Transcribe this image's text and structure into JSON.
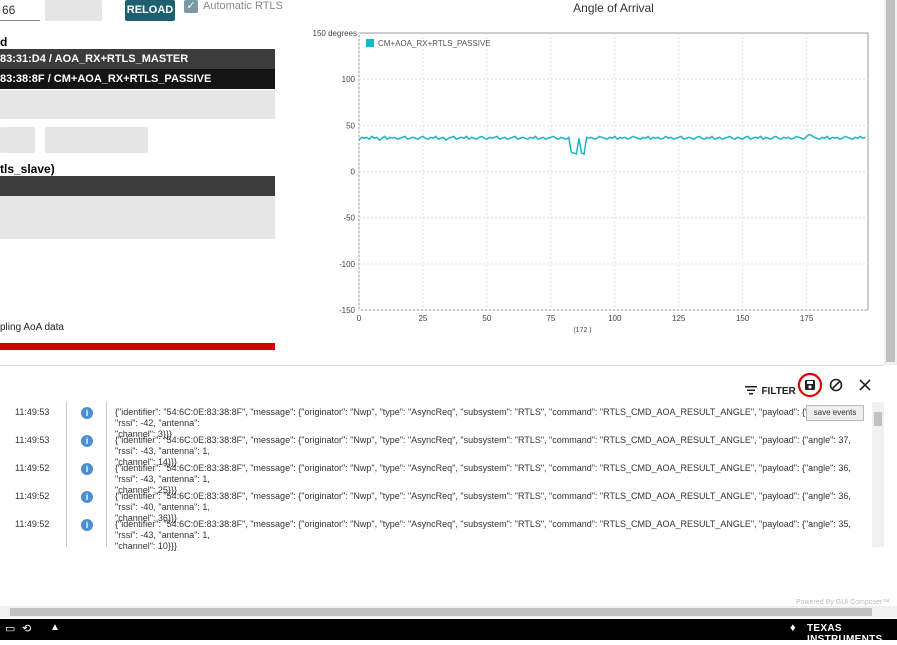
{
  "toolbar": {
    "port_value": "66",
    "reload_label": "RELOAD",
    "auto_rtls_label": "Automatic RTLS",
    "auto_rtls_checked": "✓"
  },
  "devices": {
    "title_fragment": "d",
    "items": [
      {
        "label": "83:31:D4 / AOA_RX+RTLS_MASTER"
      },
      {
        "label": "83:38:8F / CM+AOA_RX+RTLS_PASSIVE"
      }
    ]
  },
  "slave": {
    "title": "tls_slave)"
  },
  "status_text": "pling AoA data",
  "chart_data": {
    "type": "line",
    "title": "Angle of Arrival",
    "ylabel_top": "150 degrees",
    "xlabel": "(172 )",
    "xlim": [
      0,
      199
    ],
    "ylim": [
      -150,
      150
    ],
    "x_ticks": [
      0,
      25,
      50,
      75,
      100,
      125,
      150,
      175
    ],
    "y_ticks": [
      -150,
      -100,
      -50,
      0,
      50,
      100
    ],
    "grid": true,
    "legend_position": "top-left",
    "series": [
      {
        "name": "CM+AOA_RX+RTLS_PASSIVE",
        "color": "#17b6c4",
        "values": [
          34,
          37,
          36,
          37,
          35,
          38,
          36,
          37,
          34,
          36,
          38,
          35,
          37,
          36,
          37,
          35,
          36,
          37,
          38,
          35,
          36,
          37,
          36,
          35,
          37,
          38,
          36,
          35,
          37,
          36,
          38,
          35,
          36,
          37,
          34,
          36,
          37,
          38,
          35,
          36,
          37,
          36,
          38,
          35,
          37,
          36,
          35,
          37,
          38,
          36,
          35,
          37,
          36,
          37,
          38,
          35,
          36,
          37,
          35,
          36,
          37,
          38,
          35,
          36,
          37,
          36,
          35,
          37,
          36,
          38,
          35,
          36,
          37,
          35,
          36,
          37,
          38,
          36,
          35,
          37,
          36,
          35,
          37,
          21,
          20,
          19,
          36,
          20,
          19,
          37,
          36,
          37,
          35,
          36,
          38,
          37,
          36,
          35,
          37,
          36,
          38,
          35,
          37,
          36,
          37,
          35,
          36,
          38,
          37,
          36,
          35,
          37,
          36,
          38,
          35,
          37,
          36,
          37,
          35,
          36,
          38,
          36,
          37,
          35,
          36,
          37,
          38,
          35,
          36,
          37,
          36,
          35,
          37,
          38,
          36,
          35,
          37,
          36,
          38,
          35,
          36,
          37,
          35,
          36,
          37,
          38,
          36,
          35,
          37,
          36,
          35,
          37,
          38,
          35,
          36,
          37,
          36,
          38,
          35,
          37,
          36,
          35,
          37,
          38,
          36,
          35,
          37,
          36,
          37,
          35,
          36,
          38,
          37,
          36,
          35,
          38,
          40,
          39,
          37,
          36,
          35,
          37,
          36,
          38,
          35,
          37,
          36,
          37,
          35,
          36,
          38,
          37,
          36,
          35,
          37,
          36,
          38,
          36,
          37
        ]
      }
    ]
  },
  "log": {
    "filter_label": "FILTER",
    "tooltip": "save events",
    "rows": [
      {
        "time": "11:49:53",
        "msg": "{\"identifier\": \"54:6C:0E:83:38:8F\", \"message\": {\"originator\": \"Nwp\", \"type\": \"AsyncReq\", \"subsystem\": \"RTLS\", \"command\": \"RTLS_CMD_AOA_RESULT_ANGLE\", \"payload\": {\"angle\": 37, \"rssi\": -42, \"antenna\":\n\"channel\": 3}}}"
      },
      {
        "time": "11:49:53",
        "msg": "{\"identifier\": \"54:6C:0E:83:38:8F\", \"message\": {\"originator\": \"Nwp\", \"type\": \"AsyncReq\", \"subsystem\": \"RTLS\", \"command\": \"RTLS_CMD_AOA_RESULT_ANGLE\", \"payload\": {\"angle\": 37, \"rssi\": -43, \"antenna\": 1,\n\"channel\": 14}}}"
      },
      {
        "time": "11:49:52",
        "msg": "{\"identifier\": \"54:6C:0E:83:38:8F\", \"message\": {\"originator\": \"Nwp\", \"type\": \"AsyncReq\", \"subsystem\": \"RTLS\", \"command\": \"RTLS_CMD_AOA_RESULT_ANGLE\", \"payload\": {\"angle\": 36, \"rssi\": -43, \"antenna\": 1,\n\"channel\": 25}}}"
      },
      {
        "time": "11:49:52",
        "msg": "{\"identifier\": \"54:6C:0E:83:38:8F\", \"message\": {\"originator\": \"Nwp\", \"type\": \"AsyncReq\", \"subsystem\": \"RTLS\", \"command\": \"RTLS_CMD_AOA_RESULT_ANGLE\", \"payload\": {\"angle\": 36, \"rssi\": -40, \"antenna\": 1,\n\"channel\": 36}}}"
      },
      {
        "time": "11:49:52",
        "msg": "{\"identifier\": \"54:6C:0E:83:38:8F\", \"message\": {\"originator\": \"Nwp\", \"type\": \"AsyncReq\", \"subsystem\": \"RTLS\", \"command\": \"RTLS_CMD_AOA_RESULT_ANGLE\", \"payload\": {\"angle\": 35, \"rssi\": -43, \"antenna\": 1,\n\"channel\": 10}}}"
      }
    ],
    "powered_by": "Powered By GUI Composer™"
  },
  "taskbar": {
    "brand": "TEXAS INSTRUMENTS"
  }
}
